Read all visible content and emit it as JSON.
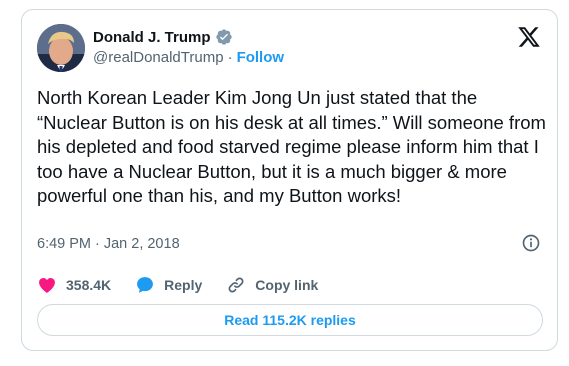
{
  "author": {
    "name": "Donald J. Trump",
    "handle": "@realDonaldTrump",
    "separator": "·",
    "follow_label": "Follow",
    "avatar_icon": "profile-photo",
    "verified_icon": "verified-badge-icon",
    "verified_color": "#829aab"
  },
  "brand": {
    "logo_icon": "x-logo-icon"
  },
  "tweet": {
    "text": "North Korean Leader Kim Jong Un just stated that the “Nuclear Button is on his desk at all times.” Will someone from his depleted and food starved regime please inform him that I too have a Nuclear Button, but it is a much bigger & more powerful one than his, and my Button works!",
    "time": "6:49 PM",
    "separator": "·",
    "date": "Jan 2, 2018",
    "info_icon": "info-icon"
  },
  "actions": {
    "likes": {
      "label": "358.4K",
      "icon": "heart-icon",
      "color": "#f91880"
    },
    "reply": {
      "label": "Reply",
      "icon": "reply-bubble-icon",
      "color": "#1d9bf0"
    },
    "copy_link": {
      "label": "Copy link",
      "icon": "link-icon"
    }
  },
  "replies_button": {
    "label": "Read 115.2K replies"
  },
  "colors": {
    "text": "#0f1419",
    "muted": "#536471",
    "accent": "#1d9bf0",
    "border": "#cfd9de"
  }
}
